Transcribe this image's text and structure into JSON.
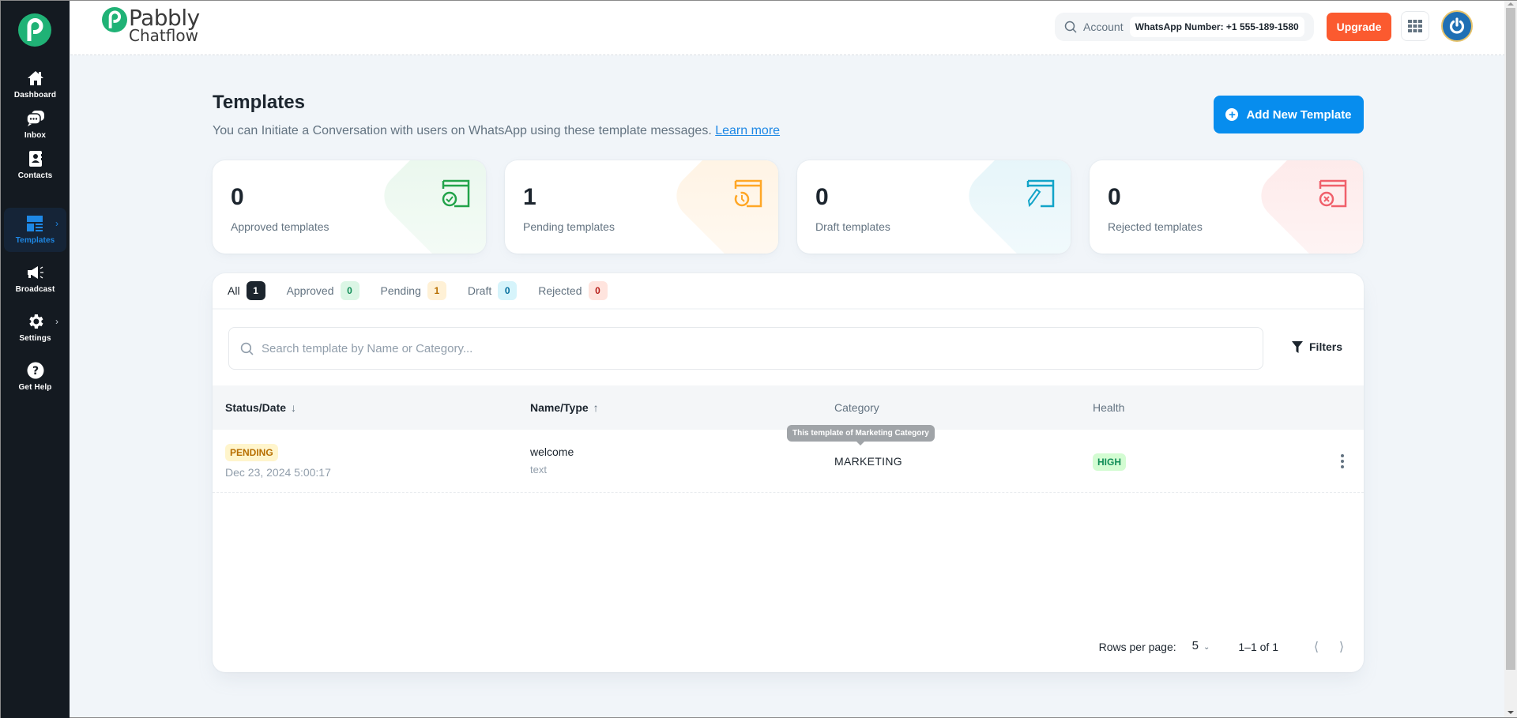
{
  "brand": {
    "name_top": "Pabbly",
    "name_bottom": "Chatflow"
  },
  "sidebar": {
    "items": [
      {
        "label": "Dashboard",
        "icon": "home-icon",
        "active": false,
        "has_chevron": false
      },
      {
        "label": "Inbox",
        "icon": "chat-bubbles-icon",
        "active": false,
        "has_chevron": false
      },
      {
        "label": "Contacts",
        "icon": "contact-book-icon",
        "active": false,
        "has_chevron": false
      },
      {
        "label": "Templates",
        "icon": "layout-template-icon",
        "active": true,
        "has_chevron": true
      },
      {
        "label": "Broadcast",
        "icon": "megaphone-icon",
        "active": false,
        "has_chevron": false
      },
      {
        "label": "Settings",
        "icon": "gear-icon",
        "active": false,
        "has_chevron": true
      },
      {
        "label": "Get Help",
        "icon": "help-circle-icon",
        "active": false,
        "has_chevron": false
      }
    ]
  },
  "header": {
    "account_label": "Account",
    "whatsapp_number": "WhatsApp Number: +1 555-189-1580",
    "upgrade_label": "Upgrade",
    "accent_upgrade": "#fb5a2f"
  },
  "page": {
    "title": "Templates",
    "subtitle": "You can Initiate a Conversation with users on WhatsApp using these template messages.",
    "learn_more": "Learn more",
    "add_button": "Add New Template",
    "accent": "#078dee"
  },
  "stats": [
    {
      "value": "0",
      "label": "Approved templates",
      "color": "#22a34a",
      "tint": "#e9f8ee"
    },
    {
      "value": "1",
      "label": "Pending templates",
      "color": "#ffa726",
      "tint": "#fff3e4"
    },
    {
      "value": "0",
      "label": "Draft templates",
      "color": "#12a4c8",
      "tint": "#e4f5fa"
    },
    {
      "value": "0",
      "label": "Rejected templates",
      "color": "#f0606b",
      "tint": "#fdeaea"
    }
  ],
  "tabs": [
    {
      "label": "All",
      "count": "1",
      "active": true,
      "bg": "#1c252e",
      "fg": "#ffffff"
    },
    {
      "label": "Approved",
      "count": "0",
      "active": false,
      "bg": "#dbf6e5",
      "fg": "#118d57"
    },
    {
      "label": "Pending",
      "count": "1",
      "active": false,
      "bg": "#fff1d6",
      "fg": "#b76e00"
    },
    {
      "label": "Draft",
      "count": "0",
      "active": false,
      "bg": "#d6f4fb",
      "fg": "#006c9c"
    },
    {
      "label": "Rejected",
      "count": "0",
      "active": false,
      "bg": "#ffe4de",
      "fg": "#b71d18"
    }
  ],
  "search": {
    "placeholder": "Search template by Name or Category...",
    "value": ""
  },
  "filters_label": "Filters",
  "table": {
    "columns": [
      {
        "label": "Status/Date",
        "sort": "desc"
      },
      {
        "label": "Name/Type",
        "sort": "asc"
      },
      {
        "label": "Category",
        "sort": ""
      },
      {
        "label": "Health",
        "sort": ""
      }
    ],
    "rows": [
      {
        "status": "PENDING",
        "date": "Dec 23, 2024 5:00:17",
        "name": "welcome",
        "type": "text",
        "category": "MARKETING",
        "category_tooltip": "This template of Marketing Category",
        "health": "HIGH"
      }
    ]
  },
  "pagination": {
    "rows_per_page_label": "Rows per page:",
    "rows_per_page": "5",
    "range": "1–1 of 1"
  }
}
